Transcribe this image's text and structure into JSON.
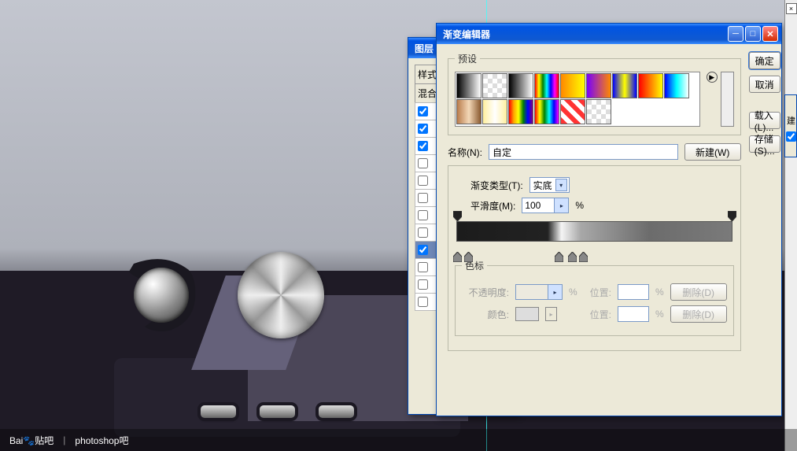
{
  "watermark": {
    "logo": "Bai🐾贴吧",
    "board": "photoshop吧"
  },
  "layerStyleDialog": {
    "title": "图层",
    "headerStyle": "样式",
    "headerBlend": "混合",
    "rows": [
      {
        "checked": true,
        "highlighted": false
      },
      {
        "checked": true,
        "highlighted": false
      },
      {
        "checked": true,
        "highlighted": false
      },
      {
        "checked": false,
        "highlighted": false
      },
      {
        "checked": false,
        "highlighted": false
      },
      {
        "checked": false,
        "highlighted": false
      },
      {
        "checked": false,
        "highlighted": false
      },
      {
        "checked": false,
        "highlighted": false
      },
      {
        "checked": true,
        "highlighted": true
      },
      {
        "checked": false,
        "highlighted": false
      },
      {
        "checked": false,
        "highlighted": false
      },
      {
        "checked": false,
        "highlighted": false
      }
    ]
  },
  "gradientEditor": {
    "title": "渐变编辑器",
    "buttons": {
      "ok": "确定",
      "cancel": "取消",
      "load": "载入(L)...",
      "save": "存储(S)...",
      "new": "新建(W)"
    },
    "presetsLegend": "预设",
    "nameLabel": "名称(N):",
    "nameValue": "自定",
    "typeLabel": "渐变类型(T):",
    "typeValue": "实底",
    "smoothLabel": "平滑度(M):",
    "smoothValue": "100",
    "pct": "%",
    "colorStopLegend": "色标",
    "opacityLabel": "不透明度:",
    "positionLabel": "位置:",
    "colorLabel": "颜色:",
    "deleteLabel": "删除(D)",
    "opacityStops": [
      0,
      100
    ],
    "colorStops": [
      0,
      4,
      37,
      42,
      46
    ]
  },
  "rightPanel": {
    "new": "建",
    "checkbox": true
  }
}
